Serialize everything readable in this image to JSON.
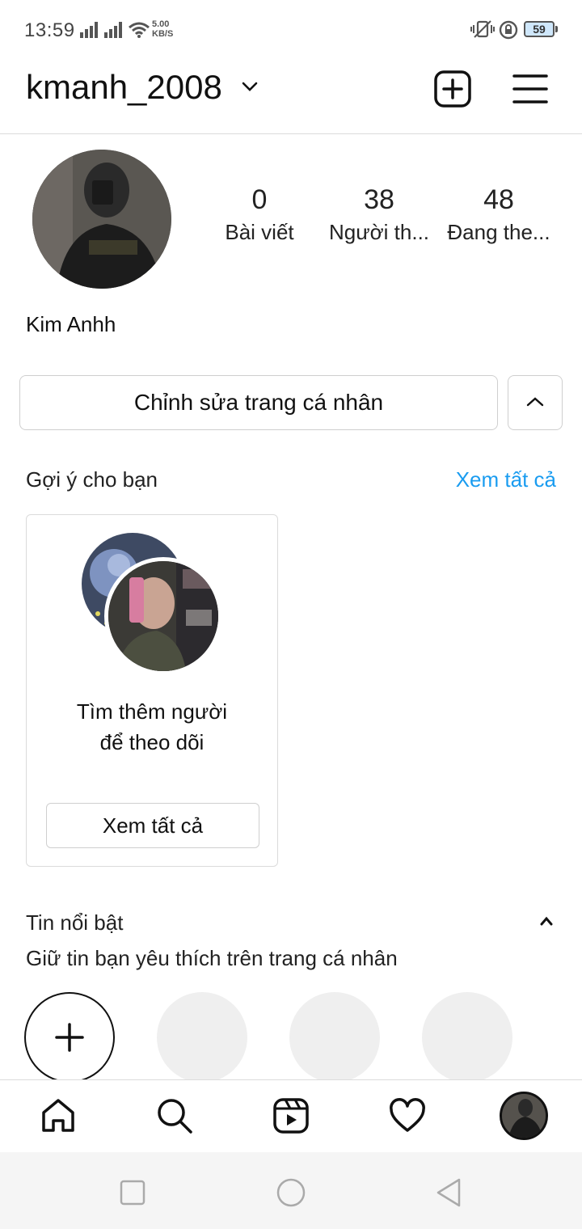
{
  "status_bar": {
    "time": "13:59",
    "net_speed_value": "5.00",
    "net_speed_unit": "KB/S",
    "battery": "59",
    "icons": [
      "signal-icon",
      "signal-icon",
      "wifi-icon",
      "vibrate-icon",
      "rotation-lock-icon",
      "battery-icon"
    ]
  },
  "header": {
    "username": "kmanh_2008",
    "icons": [
      "chevron-down-icon",
      "new-post-icon",
      "menu-icon"
    ]
  },
  "profile": {
    "stats": [
      {
        "value": "0",
        "label": "Bài viết"
      },
      {
        "value": "38",
        "label": "Người th..."
      },
      {
        "value": "48",
        "label": "Đang the..."
      }
    ],
    "display_name": "Kim Anhh",
    "edit_button": "Chỉnh sửa trang cá nhân"
  },
  "suggestions": {
    "title": "Gợi ý cho bạn",
    "see_all": "Xem tất cả",
    "card": {
      "text_line1": "Tìm thêm người",
      "text_line2": "để theo dõi",
      "button": "Xem tất cả"
    }
  },
  "highlights": {
    "title": "Tin nổi bật",
    "subtitle": "Giữ tin bạn yêu thích trên trang cá nhân"
  },
  "bottom_nav": {
    "items": [
      "home-icon",
      "search-icon",
      "reels-icon",
      "heart-icon",
      "profile-avatar"
    ]
  },
  "system_nav": {
    "items": [
      "recents-icon",
      "home-circle-icon",
      "back-icon"
    ]
  },
  "colors": {
    "accent": "#1a9cf0",
    "border": "#dbdbdb",
    "placeholder": "#efefef"
  }
}
